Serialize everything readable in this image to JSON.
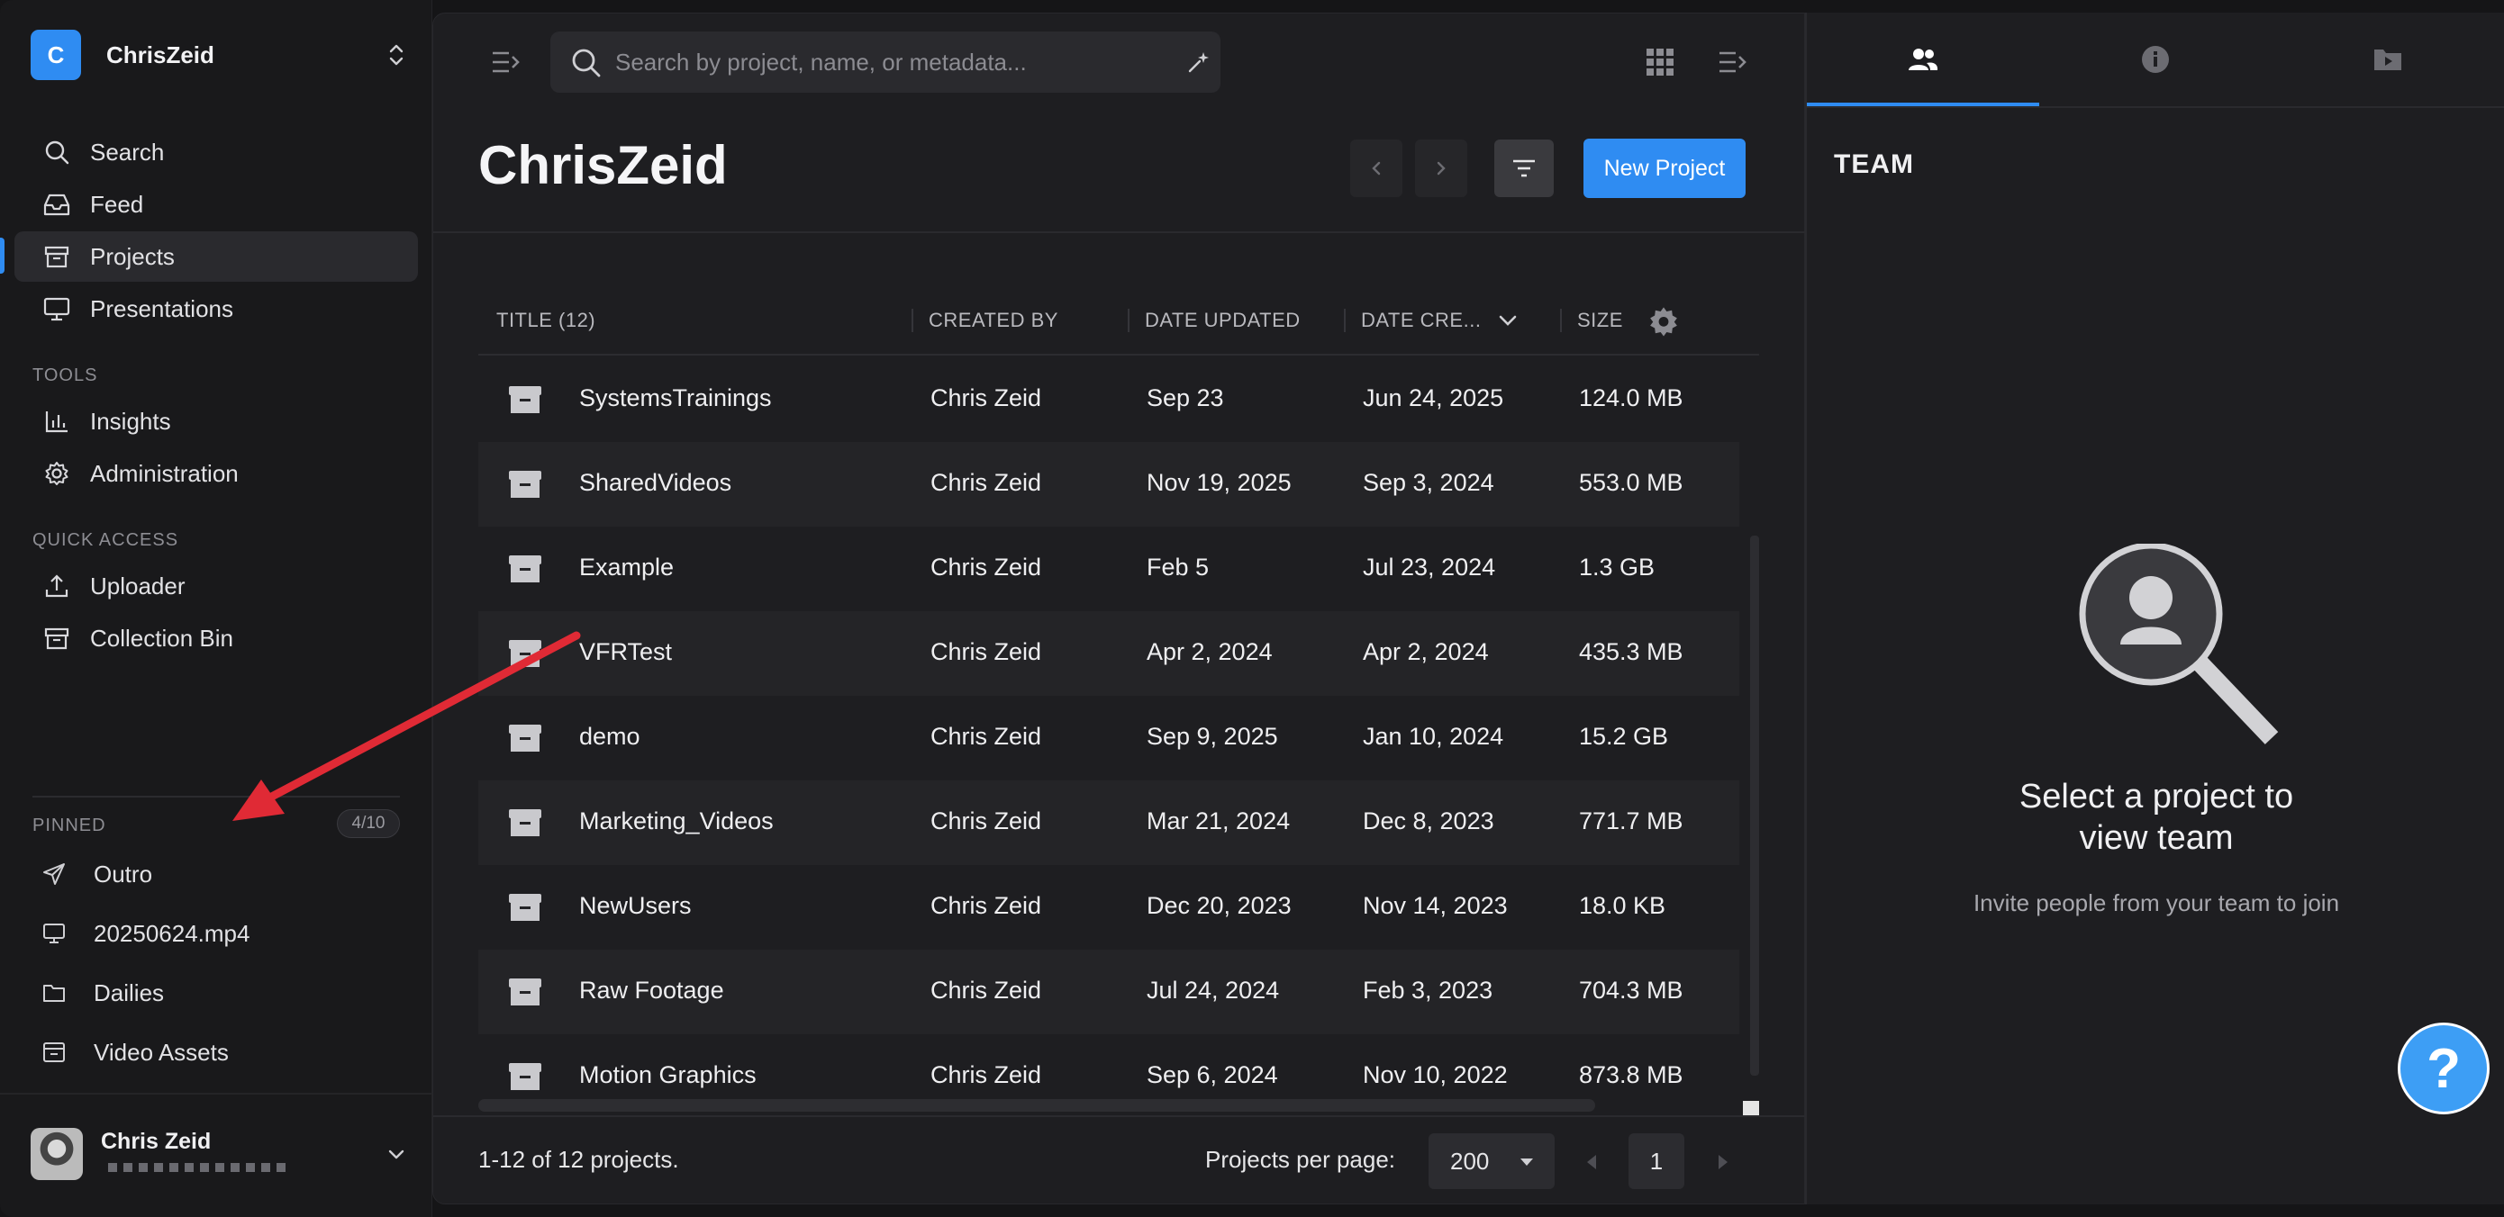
{
  "workspace": {
    "initial": "C",
    "name": "ChrisZeid"
  },
  "nav": {
    "search": "Search",
    "feed": "Feed",
    "projects": "Projects",
    "presentations": "Presentations"
  },
  "tools": {
    "label": "TOOLS",
    "insights": "Insights",
    "administration": "Administration"
  },
  "quick_access": {
    "label": "QUICK ACCESS",
    "uploader": "Uploader",
    "collection_bin": "Collection Bin"
  },
  "pinned": {
    "label": "PINNED",
    "count": "4/10",
    "items": [
      "Outro",
      "20250624.mp4",
      "Dailies",
      "Video Assets"
    ]
  },
  "user": {
    "name": "Chris Zeid"
  },
  "search": {
    "placeholder": "Search by project, name, or metadata..."
  },
  "page": {
    "title": "ChrisZeid",
    "new_project": "New Project"
  },
  "table": {
    "columns": {
      "title": "TITLE (12)",
      "created_by": "CREATED BY",
      "date_updated": "DATE UPDATED",
      "date_created": "DATE CRE...",
      "size": "SIZE"
    },
    "rows": [
      {
        "title": "SystemsTrainings",
        "created_by": "Chris Zeid",
        "updated": "Sep 23",
        "created": "Jun 24, 2025",
        "size": "124.0 MB"
      },
      {
        "title": "SharedVideos",
        "created_by": "Chris Zeid",
        "updated": "Nov 19, 2025",
        "created": "Sep 3, 2024",
        "size": "553.0 MB"
      },
      {
        "title": "Example",
        "created_by": "Chris Zeid",
        "updated": "Feb 5",
        "created": "Jul 23, 2024",
        "size": "1.3 GB"
      },
      {
        "title": "VFRTest",
        "created_by": "Chris Zeid",
        "updated": "Apr 2, 2024",
        "created": "Apr 2, 2024",
        "size": "435.3 MB"
      },
      {
        "title": "demo",
        "created_by": "Chris Zeid",
        "updated": "Sep 9, 2025",
        "created": "Jan 10, 2024",
        "size": "15.2 GB"
      },
      {
        "title": "Marketing_Videos",
        "created_by": "Chris Zeid",
        "updated": "Mar 21, 2024",
        "created": "Dec 8, 2023",
        "size": "771.7 MB"
      },
      {
        "title": "NewUsers",
        "created_by": "Chris Zeid",
        "updated": "Dec 20, 2023",
        "created": "Nov 14, 2023",
        "size": "18.0 KB"
      },
      {
        "title": "Raw Footage",
        "created_by": "Chris Zeid",
        "updated": "Jul 24, 2024",
        "created": "Feb 3, 2023",
        "size": "704.3 MB"
      },
      {
        "title": "Motion Graphics",
        "created_by": "Chris Zeid",
        "updated": "Sep 6, 2024",
        "created": "Nov 10, 2022",
        "size": "873.8 MB"
      }
    ]
  },
  "footer": {
    "count": "1-12 of 12 projects.",
    "per_page_label": "Projects per page:",
    "per_page": "200",
    "page": "1"
  },
  "right_panel": {
    "section": "TEAM",
    "empty_title_line1": "Select a project to",
    "empty_title_line2": "view team",
    "empty_sub": "Invite people from your team to join"
  },
  "help": {
    "label": "?"
  },
  "colors": {
    "accent": "#2f8cf2",
    "annotation_arrow": "#e02a35"
  }
}
